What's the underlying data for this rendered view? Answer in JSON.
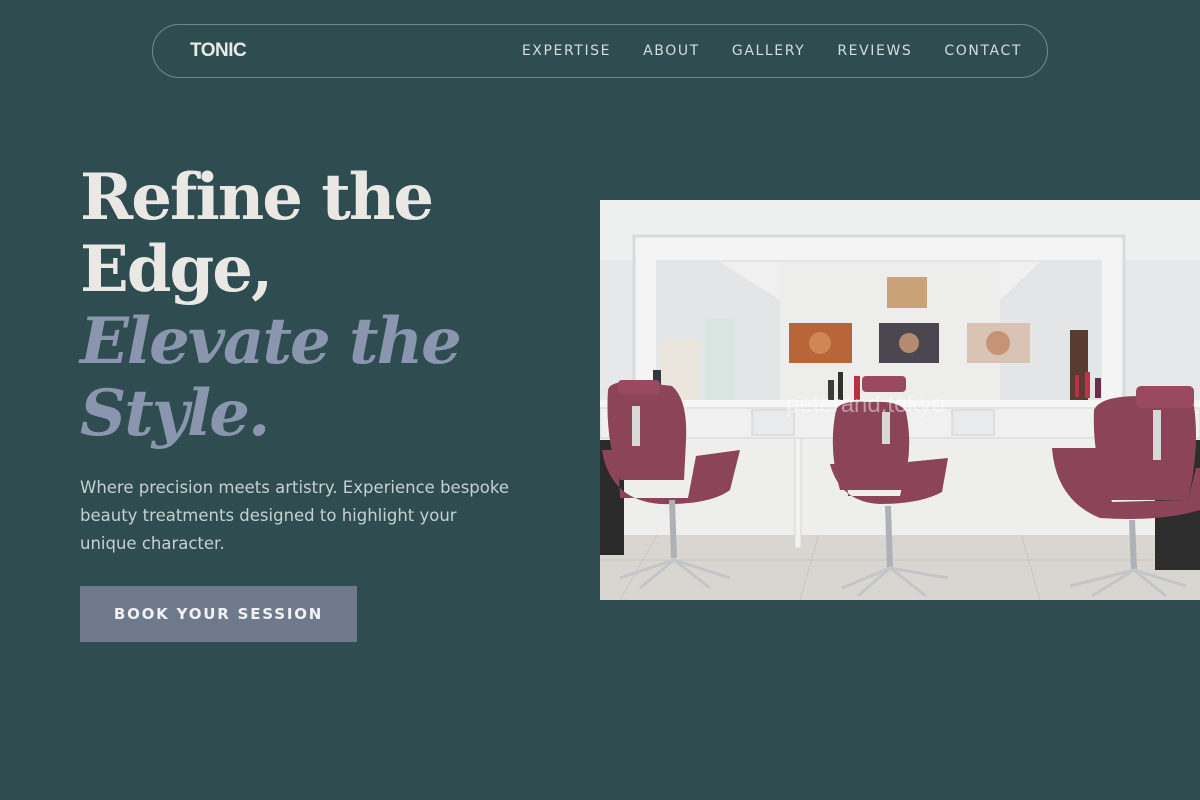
{
  "nav": {
    "brand": "TONIC",
    "items": [
      {
        "label": "EXPERTISE"
      },
      {
        "label": "ABOUT"
      },
      {
        "label": "GALLERY"
      },
      {
        "label": "REVIEWS"
      },
      {
        "label": "CONTACT"
      }
    ]
  },
  "hero": {
    "title_line1": "Refine the",
    "title_line2": "Edge,",
    "title_accent1": "Elevate the",
    "title_accent2": "Style.",
    "subtitle": "Where precision meets artistry. Experience bespoke beauty treatments designed to highlight your unique character.",
    "cta_label": "BOOK YOUR SESSION"
  },
  "image": {
    "watermark": "peterand.tokyo",
    "alt": "Salon interior with pink barber chairs in front of a long mirror"
  },
  "colors": {
    "background": "#2f4d50",
    "accent": "#8996ae",
    "button": "#6e7a8c"
  }
}
